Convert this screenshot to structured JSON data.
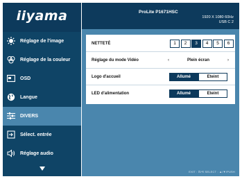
{
  "brand": "iiyama",
  "header": {
    "model": "ProLite P1671HSC",
    "resolution": "1920 X 1080   60Hz",
    "input": "USB C  2"
  },
  "menu": [
    {
      "label": "Réglage de l'image",
      "icon": "contrast-icon"
    },
    {
      "label": "Réglage de la couleur",
      "icon": "color-icon"
    },
    {
      "label": "OSD",
      "icon": "osd-icon"
    },
    {
      "label": "Langue",
      "icon": "globe-icon"
    },
    {
      "label": "DIVERS",
      "icon": "sliders-icon",
      "active": true
    },
    {
      "label": "Sélect. entrée",
      "icon": "input-icon"
    },
    {
      "label": "Réglage audio",
      "icon": "speaker-icon"
    }
  ],
  "settings": {
    "sharpness": {
      "label": "NETTETÉ",
      "options": [
        "1",
        "2",
        "3",
        "4",
        "5",
        "6"
      ],
      "selected": "3"
    },
    "video_mode": {
      "label": "Réglage du mode Vidéo",
      "left": "‹",
      "value": "Plein écran",
      "right": "›"
    },
    "boot_logo": {
      "label": "Logo d'accueil",
      "on": "Allumé",
      "off": "Eteint",
      "selected": "on"
    },
    "power_led": {
      "label": "LED d'alimentation",
      "on": "Allumé",
      "off": "Eteint",
      "selected": "on"
    }
  },
  "footer": "EXIT : ⊡/⟲ SELECT : ▲/▼/PUSH",
  "colors": {
    "dark": "#0d3a5c",
    "active": "#4a86ad",
    "menu": "#0f4466"
  }
}
